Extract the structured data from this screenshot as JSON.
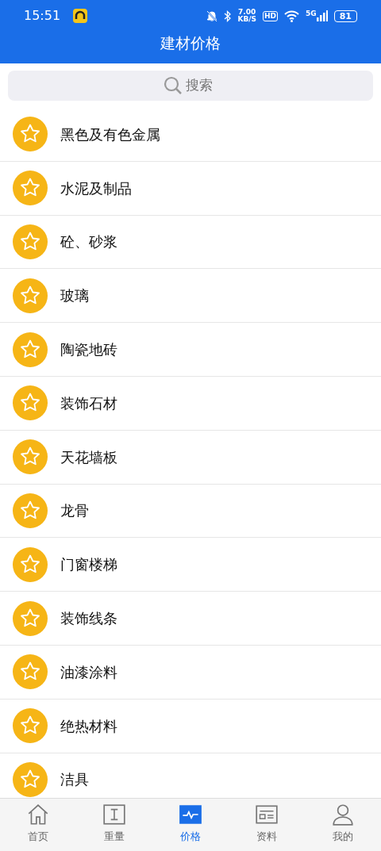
{
  "status_bar": {
    "time": "15:51",
    "speed": "7.00",
    "speed_unit": "KB/S",
    "hd": "HD",
    "network": "5G",
    "battery": "81"
  },
  "title": "建材价格",
  "search": {
    "placeholder": "搜索"
  },
  "categories": [
    {
      "label": "黑色及有色金属"
    },
    {
      "label": "水泥及制品"
    },
    {
      "label": "砼、砂浆"
    },
    {
      "label": "玻璃"
    },
    {
      "label": "陶瓷地砖"
    },
    {
      "label": "装饰石材"
    },
    {
      "label": "天花墙板"
    },
    {
      "label": "龙骨"
    },
    {
      "label": "门窗楼梯"
    },
    {
      "label": "装饰线条"
    },
    {
      "label": "油漆涂料"
    },
    {
      "label": "绝热材料"
    },
    {
      "label": "洁具"
    }
  ],
  "tabs": [
    {
      "label": "首页",
      "kind": "home",
      "selected": false
    },
    {
      "label": "重量",
      "kind": "text",
      "selected": false
    },
    {
      "label": "价格",
      "kind": "pulse",
      "selected": true
    },
    {
      "label": "资料",
      "kind": "doc",
      "selected": false
    },
    {
      "label": "我的",
      "kind": "person",
      "selected": false
    }
  ]
}
